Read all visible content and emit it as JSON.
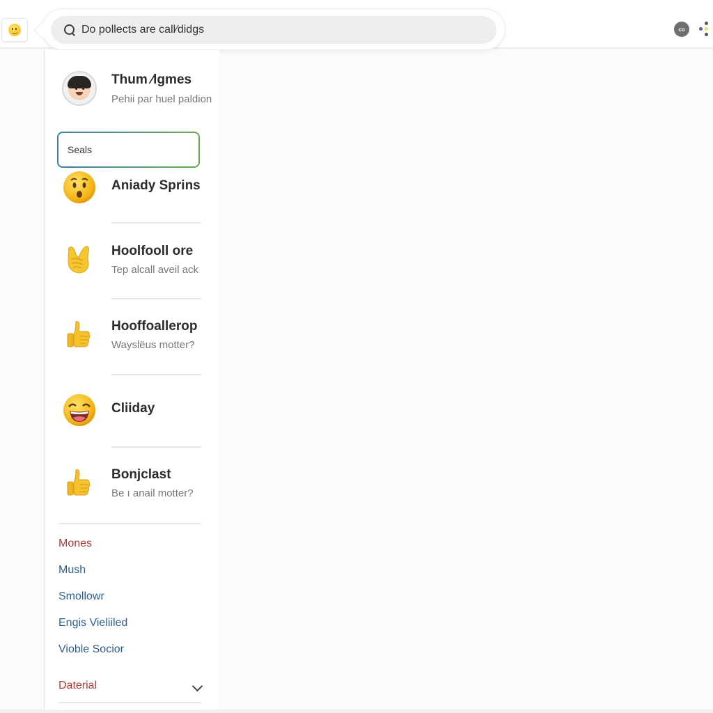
{
  "topbar": {
    "emoji_button_icon": "smiley-face-icon",
    "search": {
      "value": "Do pollects are call⁄didgs",
      "icon": "search-icon"
    },
    "account_badge": "co",
    "more_icon": "more-dots-icon",
    "more_dot_colors": [
      "#6a5a8c",
      "#555555",
      "#e3e36a",
      "#555555"
    ]
  },
  "profile": {
    "name": "Thum ⁄lgmes",
    "subtitle": "Pehii par huel paldion",
    "icon": "avatar-face-icon"
  },
  "filter_input": {
    "value": "Seals",
    "border_colors": [
      "#3b80ad",
      "#6aab4e"
    ]
  },
  "contacts": [
    {
      "name": "Aniady Sprins",
      "subtitle": "",
      "icon": "surprised-face-emoji"
    },
    {
      "name": "Hoolfooll ore",
      "subtitle": "Tep alcall aveil ack",
      "icon": "crossed-fingers-emoji"
    },
    {
      "name": "Hooffoallerop",
      "subtitle": "Wayslëus motter?",
      "icon": "thumbs-up-emoji"
    },
    {
      "name": "Cliiday",
      "subtitle": "",
      "icon": "laughing-face-emoji"
    },
    {
      "name": "Bonjclast",
      "subtitle": "Be ı anail motter?",
      "icon": "thumbs-up-emoji"
    }
  ],
  "links": [
    {
      "label": "Mones",
      "color": "#b03a3a"
    },
    {
      "label": "Mush",
      "color": "#2f5f8f"
    },
    {
      "label": "Smollowr",
      "color": "#2f5f8f"
    },
    {
      "label": "Engis Vieliiled",
      "color": "#2f5f8f"
    },
    {
      "label": "Vioble Socior",
      "color": "#2f5f8f"
    }
  ],
  "section_dropdown": {
    "label": "Daterial",
    "color": "#b03a3a",
    "icon": "chevron-down-icon"
  }
}
